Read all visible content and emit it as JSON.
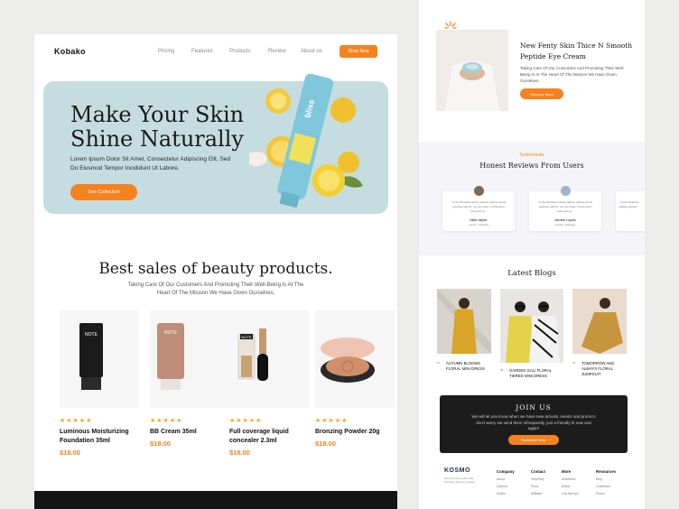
{
  "landing": {
    "logo": "Kobako",
    "nav": [
      "Pricing",
      "Features",
      "Products",
      "Review",
      "About us"
    ],
    "shop_button": "Shop Now",
    "hero": {
      "title": "Make Your Skin Shine Naturally",
      "subtitle": "Lorem Ipsum Dolor Sit Amet, Consectetur Adipiscing Elit, Sed Do Eiusmod Tempor Incididunt Ut Labore.",
      "button": "See Collection",
      "tube_brand": "bliss"
    },
    "best_sales": {
      "title": "Best sales of beauty products.",
      "subtitle": "Taking Care Of Our Customers And Promoting Their Well-Being Is At The Heart Of The Mission We Have Given Ourselves."
    },
    "products": [
      {
        "name": "Luminous Moisturizing Foundation 35ml",
        "price": "$18.00",
        "rating": "★★★★★",
        "brand": "NOTE"
      },
      {
        "name": "BB Cream 35ml",
        "price": "$18.00",
        "rating": "★★★★★",
        "brand": "NOTE"
      },
      {
        "name": "Full coverage liquid concealer 2.3ml",
        "price": "$18.00",
        "rating": "★★★★★",
        "brand": "NOTE"
      },
      {
        "name": "Bronzing Powder 20g",
        "price": "$18.00",
        "rating": "★★★★★",
        "brand": ""
      }
    ]
  },
  "mobile": {
    "feature": {
      "title": "New Fenty Skin Thice N Smooth Peptide Eye Cream",
      "subtitle": "Taking Care Of Our Customers And Promoting Their Well-Being Is At The Heart Of The Mission We Have Given Ourselves.",
      "button": "Discover More"
    },
    "testimonials": {
      "kicker": "Testimonials",
      "title": "Honest Reviews From Users",
      "cards": [
        {
          "text": "“In the Windows setting partner partner set lie organise partner, we can scale. If dimension and we'll up.”",
          "name": "Mike taylor",
          "location": "Lahore, Pakistan"
        },
        {
          "text": "“In the Windows setting partner partner set lie organise partner, we can scale. If dimension and we'll up.”",
          "name": "James Lopez",
          "location": "Lahore, Pakistan"
        },
        {
          "text": "“In the Windows setting partner”",
          "name": "",
          "location": ""
        }
      ]
    },
    "blogs": {
      "title": "Latest Blogs",
      "items": [
        {
          "date": "07",
          "name": "AUTUMN BLOOMS FLORAL MINI DRESS"
        },
        {
          "date": "09",
          "name": "GARDEN GALI FLORAL TIERED MINI DRESS"
        },
        {
          "date": "04",
          "name": "TOMORROW AND ALWAYS FLORAL JUMPSUIT"
        }
      ]
    },
    "join": {
      "title": "JOIN US",
      "subtitle": "We will let you know when we have new arrivals, events and promo's don't worry we send them infrequently, just a friendly hi now and again!",
      "button": "Subscribe Now"
    },
    "footer": {
      "logo": "KOSMO",
      "tagline": "Some text here to give a little description about the company",
      "columns": [
        {
          "heading": "Company",
          "items": [
            "About",
            "Careers",
            "Mobile"
          ]
        },
        {
          "heading": "Contact",
          "items": [
            "Help/FAQ",
            "Press",
            "Affiliates"
          ]
        },
        {
          "heading": "More",
          "items": [
            "Airlinefees",
            "Airline",
            "Low fare tips"
          ]
        },
        {
          "heading": "Resources",
          "items": [
            "Blog",
            "Collections",
            "Promo"
          ]
        }
      ]
    }
  },
  "colors": {
    "accent": "#f5821f",
    "hero_bg": "#c5dde1",
    "star": "#f5a623",
    "dark": "#1c1c1c"
  }
}
